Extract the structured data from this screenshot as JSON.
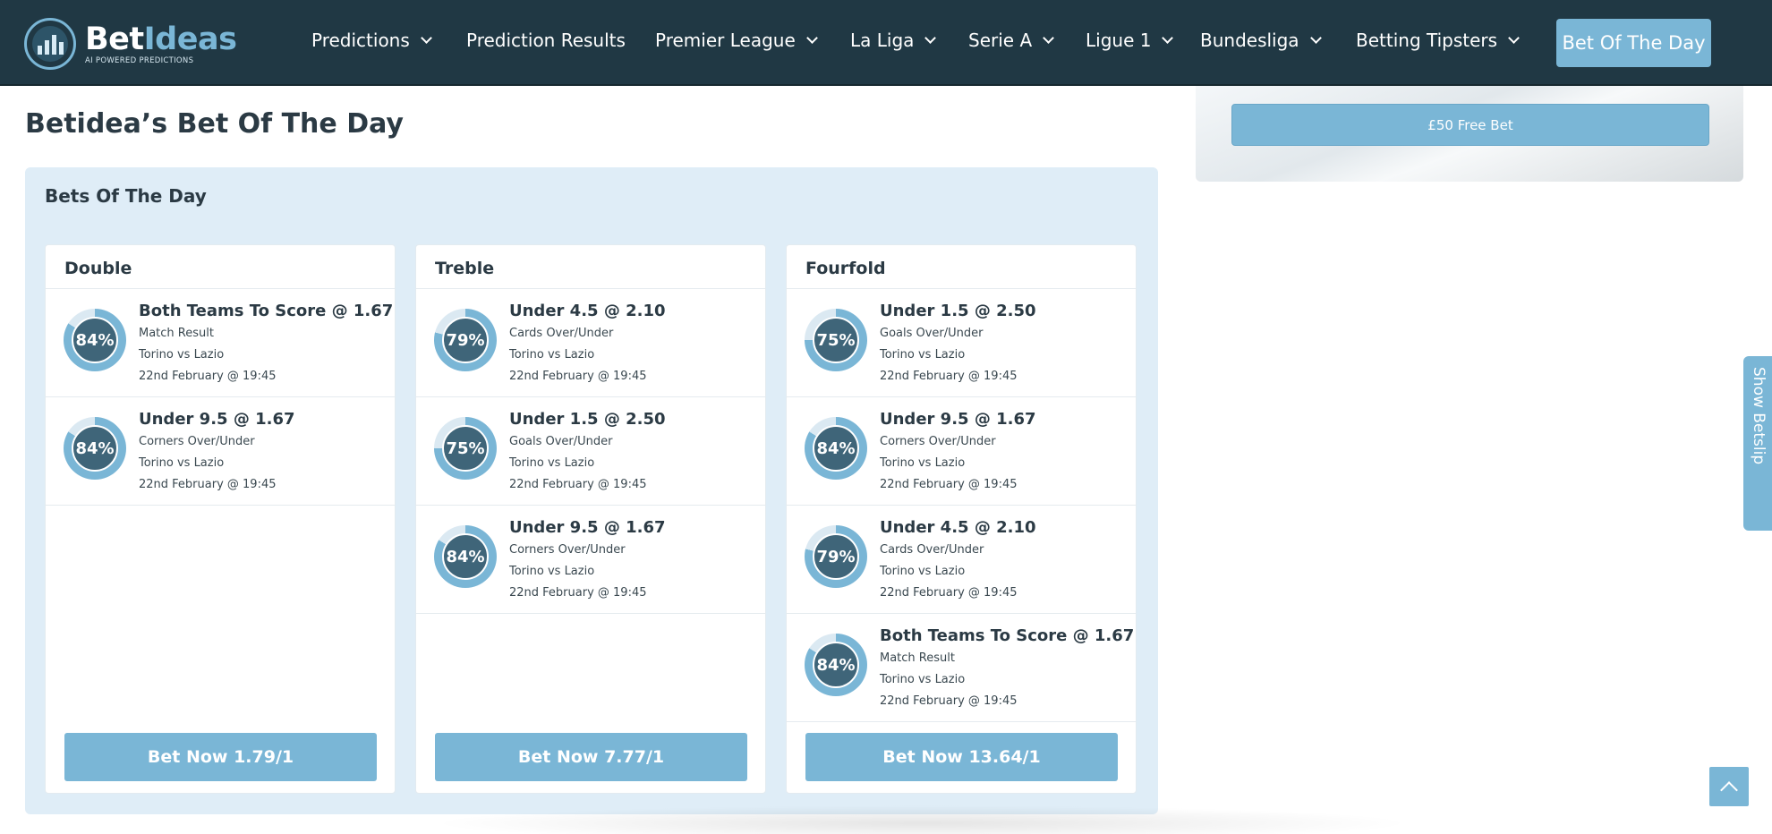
{
  "brand": {
    "name_part1": "Bet",
    "name_part2": "Ideas",
    "tagline": "AI POWERED PREDICTIONS",
    "accent_color": "#7ab6d6",
    "nav_color": "#203844"
  },
  "nav": {
    "items": [
      {
        "label": "Predictions",
        "dropdown": true
      },
      {
        "label": "Prediction Results",
        "dropdown": false
      },
      {
        "label": "Premier League",
        "dropdown": true
      },
      {
        "label": "La Liga",
        "dropdown": true
      },
      {
        "label": "Serie A",
        "dropdown": true
      },
      {
        "label": "Ligue 1",
        "dropdown": true
      },
      {
        "label": "Bundesliga",
        "dropdown": true
      },
      {
        "label": "Betting Tipsters",
        "dropdown": true
      }
    ],
    "cta_label": "Bet Of The Day"
  },
  "page_title": "Betidea’s Bet Of The Day",
  "promo": {
    "button_label": "£50 Free Bet"
  },
  "panel": {
    "title": "Bets Of The Day",
    "cards": [
      {
        "title": "Double",
        "button_label": "Bet Now 1.79/1",
        "bets": [
          {
            "percent": "84%",
            "level": 0.84,
            "title": "Both Teams To Score @ 1.67",
            "market": "Match Result",
            "match": "Torino vs Lazio",
            "time": "22nd February @ 19:45"
          },
          {
            "percent": "84%",
            "level": 0.84,
            "title": "Under 9.5 @ 1.67",
            "market": "Corners Over/Under",
            "match": "Torino vs Lazio",
            "time": "22nd February @ 19:45"
          }
        ]
      },
      {
        "title": "Treble",
        "button_label": "Bet Now 7.77/1",
        "bets": [
          {
            "percent": "79%",
            "level": 0.79,
            "title": "Under 4.5 @ 2.10",
            "market": "Cards Over/Under",
            "match": "Torino vs Lazio",
            "time": "22nd February @ 19:45"
          },
          {
            "percent": "75%",
            "level": 0.75,
            "title": "Under 1.5 @ 2.50",
            "market": "Goals Over/Under",
            "match": "Torino vs Lazio",
            "time": "22nd February @ 19:45"
          },
          {
            "percent": "84%",
            "level": 0.84,
            "title": "Under 9.5 @ 1.67",
            "market": "Corners Over/Under",
            "match": "Torino vs Lazio",
            "time": "22nd February @ 19:45"
          }
        ]
      },
      {
        "title": "Fourfold",
        "button_label": "Bet Now 13.64/1",
        "bets": [
          {
            "percent": "75%",
            "level": 0.75,
            "title": "Under 1.5 @ 2.50",
            "market": "Goals Over/Under",
            "match": "Torino vs Lazio",
            "time": "22nd February @ 19:45"
          },
          {
            "percent": "84%",
            "level": 0.84,
            "title": "Under 9.5 @ 1.67",
            "market": "Corners Over/Under",
            "match": "Torino vs Lazio",
            "time": "22nd February @ 19:45"
          },
          {
            "percent": "79%",
            "level": 0.79,
            "title": "Under 4.5 @ 2.10",
            "market": "Cards Over/Under",
            "match": "Torino vs Lazio",
            "time": "22nd February @ 19:45"
          },
          {
            "percent": "84%",
            "level": 0.84,
            "title": "Both Teams To Score @ 1.67",
            "market": "Match Result",
            "match": "Torino vs Lazio",
            "time": "22nd February @ 19:45"
          }
        ]
      }
    ]
  },
  "betslip_tab_label": "Show Betslip",
  "icons": {
    "logo": "bar-chart-logo-icon",
    "dropdown": "chevron-down-icon",
    "scroll_top": "chevron-up-icon"
  }
}
